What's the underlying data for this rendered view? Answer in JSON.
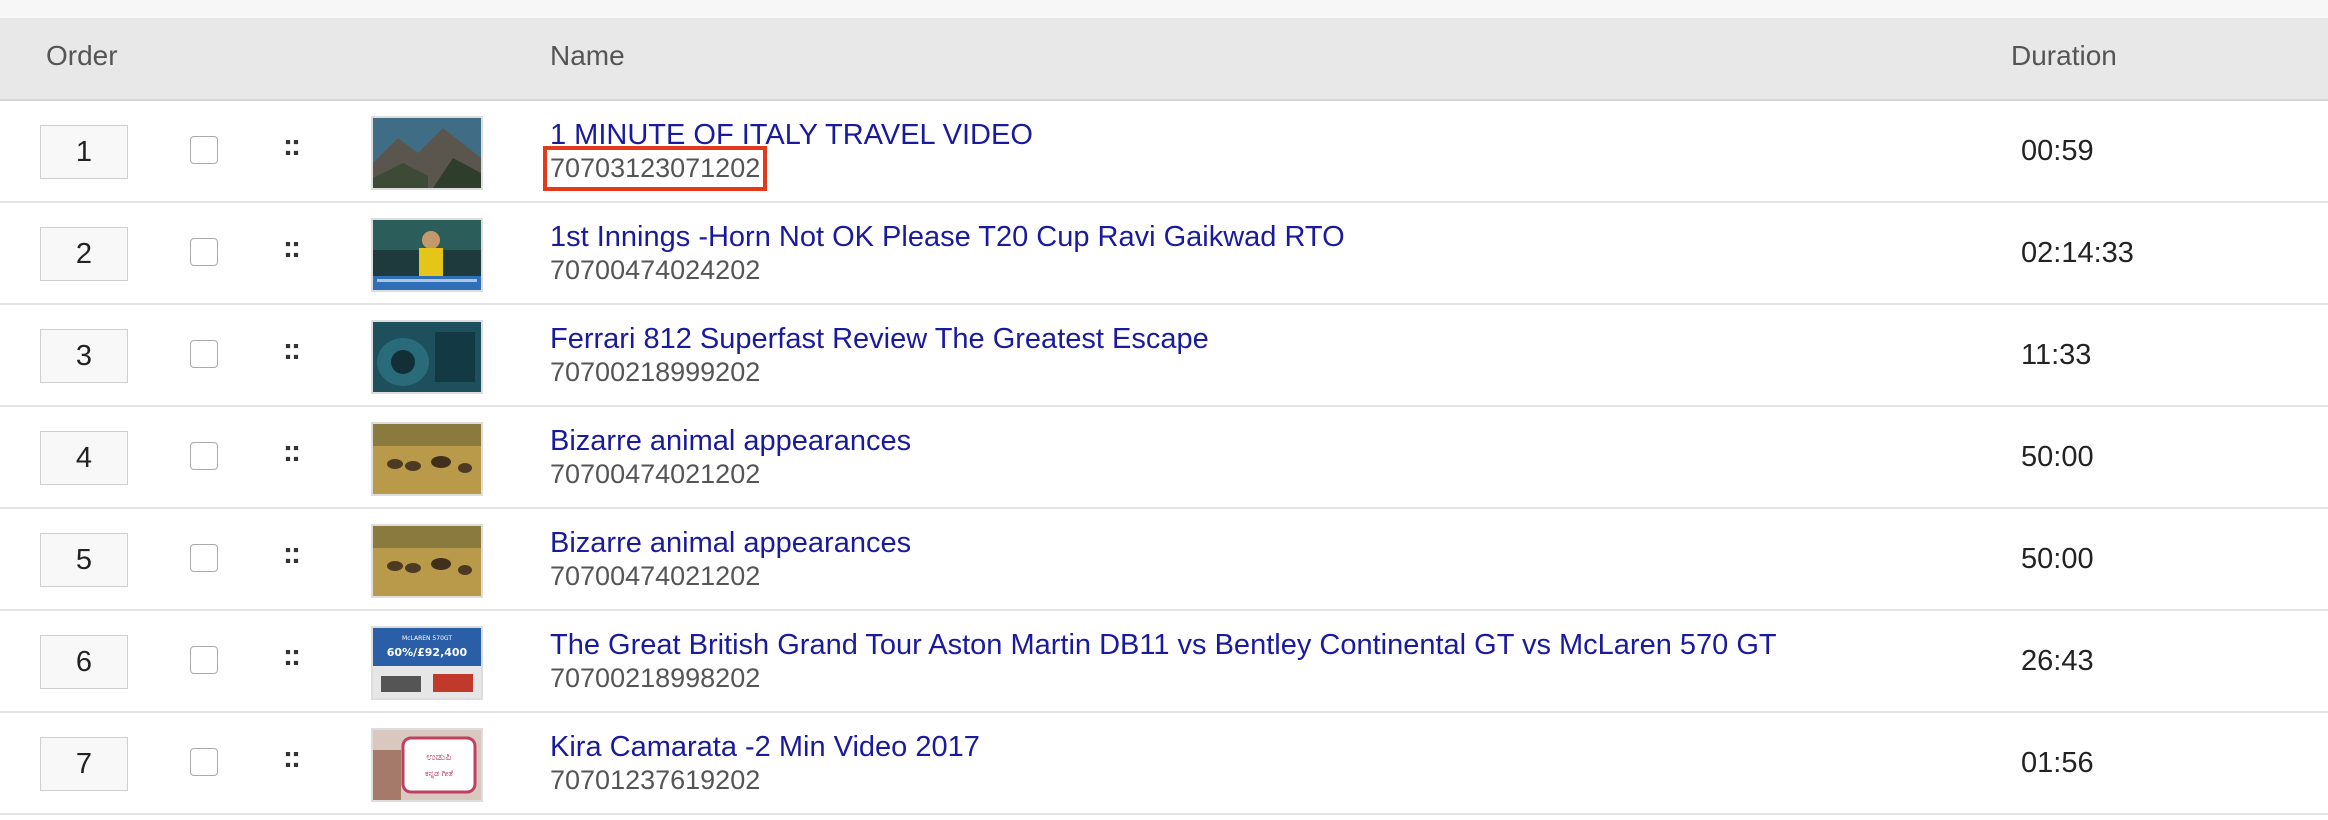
{
  "header": {
    "order": "Order",
    "name": "Name",
    "duration": "Duration"
  },
  "rows": [
    {
      "order": "1",
      "title": "1 MINUTE OF ITALY TRAVEL VIDEO",
      "id": "70703123071202",
      "duration": "00:59"
    },
    {
      "order": "2",
      "title": "1st Innings -Horn Not OK Please T20 Cup Ravi Gaikwad RTO",
      "id": "70700474024202",
      "duration": "02:14:33"
    },
    {
      "order": "3",
      "title": "Ferrari 812 Superfast Review The Greatest Escape",
      "id": "70700218999202",
      "duration": "11:33"
    },
    {
      "order": "4",
      "title": "Bizarre animal appearances",
      "id": "70700474021202",
      "duration": "50:00"
    },
    {
      "order": "5",
      "title": "Bizarre animal appearances",
      "id": "70700474021202",
      "duration": "50:00"
    },
    {
      "order": "6",
      "title": "The Great British Grand Tour Aston Martin DB11 vs Bentley Continental GT vs McLaren 570 GT",
      "id": "70700218998202",
      "duration": "26:43"
    },
    {
      "order": "7",
      "title": "Kira Camarata -2 Min Video 2017",
      "id": "70701237619202",
      "duration": "01:56"
    }
  ],
  "drag_handle": "::",
  "thumb6_text": {
    "brand": "McLAREN 570GT",
    "price": "60%/£92,400"
  },
  "thumb7_text": {
    "line1": "ಉಡುಪಿ",
    "line2": "ಕನ್ನಡ ಗೀತೆ"
  }
}
